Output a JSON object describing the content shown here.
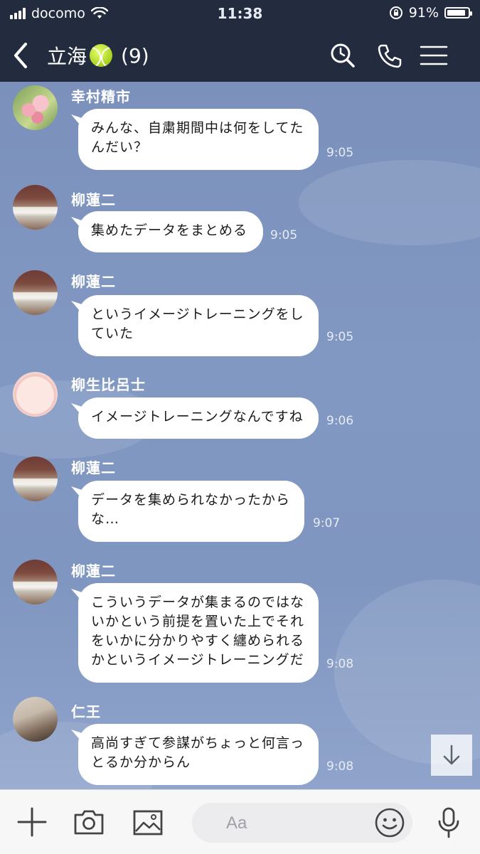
{
  "status_bar": {
    "carrier": "docomo",
    "time": "11:38",
    "battery": "91%",
    "battery_level": 0.91
  },
  "header": {
    "title": "立海",
    "member_count": "(9)",
    "title_emoji_icon": "tennis-ball-icon"
  },
  "messages": [
    {
      "sender": "幸村精市",
      "text": "みんな、自粛期間中は何をしてたんだい？",
      "time": "9:05",
      "avatar": "flower-avatar"
    },
    {
      "sender": "柳蓮二",
      "text": "集めたデータをまとめる",
      "time": "9:05",
      "avatar": "book-avatar"
    },
    {
      "sender": "柳蓮二",
      "text": "というイメージトレーニングをしていた",
      "time": "9:05",
      "avatar": "book-avatar"
    },
    {
      "sender": "柳生比呂士",
      "text": "イメージトレーニングなんですね",
      "time": "9:06",
      "avatar": "glasses-avatar"
    },
    {
      "sender": "柳蓮二",
      "text": "データを集められなかったからな…",
      "time": "9:07",
      "avatar": "book-avatar"
    },
    {
      "sender": "柳蓮二",
      "text": "こういうデータが集まるのではないかという前提を置いた上でそれをいかに分かりやすく纏められるかというイメージトレーニングだ",
      "time": "9:08",
      "avatar": "book-avatar"
    },
    {
      "sender": "仁王",
      "text": "高尚すぎて参謀がちょっと何言っとるか分からん",
      "time": "9:08",
      "avatar": "cards-avatar"
    }
  ],
  "input": {
    "placeholder": "Aa"
  },
  "colors": {
    "header_bg": "#232b3f",
    "chat_bg": "#7d93bd",
    "bubble_bg": "#ffffff"
  }
}
